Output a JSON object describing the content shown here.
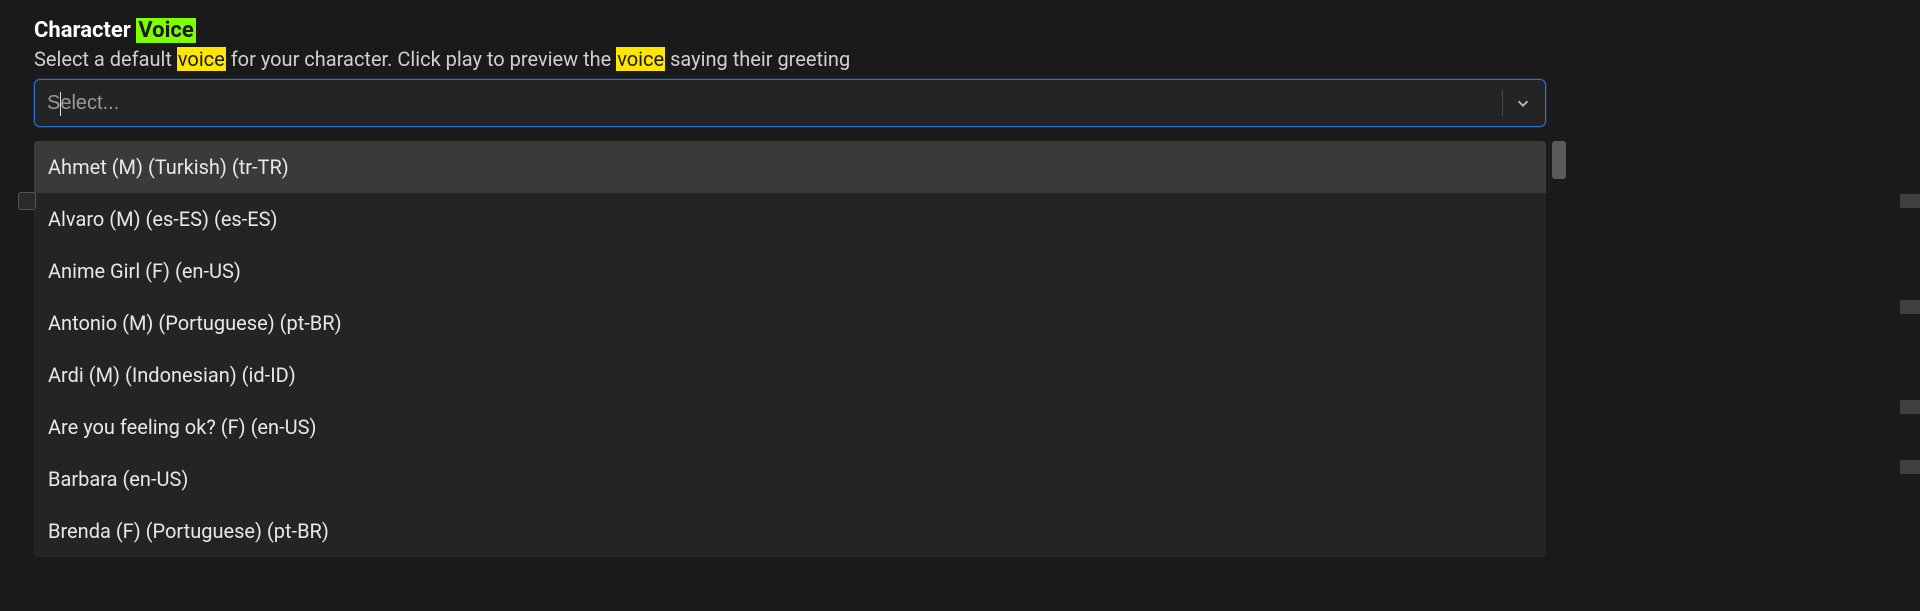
{
  "heading": {
    "prefix": "Character ",
    "highlight": "Voice"
  },
  "subheading": {
    "part1": "Select a default ",
    "hl1": "voice",
    "part2": " for your character. Click play to preview the ",
    "hl2": "voice",
    "part3": " saying their greeting"
  },
  "select": {
    "placeholder": "Select...",
    "value": ""
  },
  "options": [
    {
      "label": "Ahmet (M) (Turkish) (tr-TR)",
      "highlighted": true
    },
    {
      "label": "Alvaro (M) (es-ES) (es-ES)",
      "highlighted": false
    },
    {
      "label": "Anime Girl (F) (en-US)",
      "highlighted": false
    },
    {
      "label": "Antonio (M) (Portuguese) (pt-BR)",
      "highlighted": false
    },
    {
      "label": "Ardi (M) (Indonesian) (id-ID)",
      "highlighted": false
    },
    {
      "label": "Are you feeling ok? (F) (en-US)",
      "highlighted": false
    },
    {
      "label": "Barbara (en-US)",
      "highlighted": false
    },
    {
      "label": "Brenda (F) (Portuguese) (pt-BR)",
      "highlighted": false
    }
  ],
  "sideMarkTops": [
    194,
    300,
    400,
    460
  ]
}
